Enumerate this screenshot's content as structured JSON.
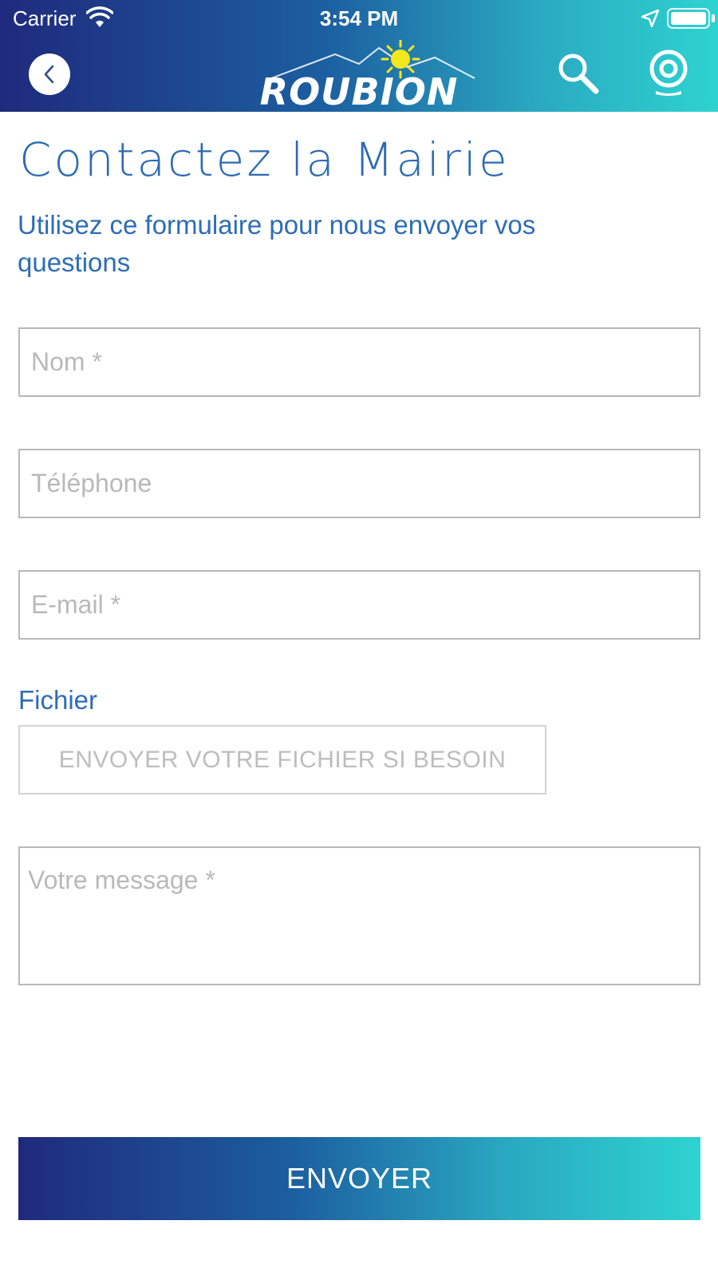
{
  "status_bar": {
    "carrier": "Carrier",
    "time": "3:54 PM"
  },
  "header": {
    "logo_text": "ROUBION",
    "back_icon": "chevron-left-icon",
    "search_icon": "search-icon",
    "webcam_icon": "webcam-icon"
  },
  "page": {
    "title": "Contactez la Mairie",
    "subtitle": "Utilisez ce formulaire pour nous envoyer vos questions"
  },
  "form": {
    "nom_placeholder": "Nom *",
    "telephone_placeholder": "Téléphone",
    "email_placeholder": "E-mail *",
    "fichier_label": "Fichier",
    "fichier_button": "ENVOYER VOTRE FICHIER SI BESOIN",
    "message_placeholder": "Votre message *",
    "submit_label": "ENVOYER"
  },
  "colors": {
    "gradient_start": "#1f2a7d",
    "gradient_end": "#2ed3d0",
    "title_blue": "#2c6bb3",
    "placeholder_gray": "#b9b9b9"
  }
}
